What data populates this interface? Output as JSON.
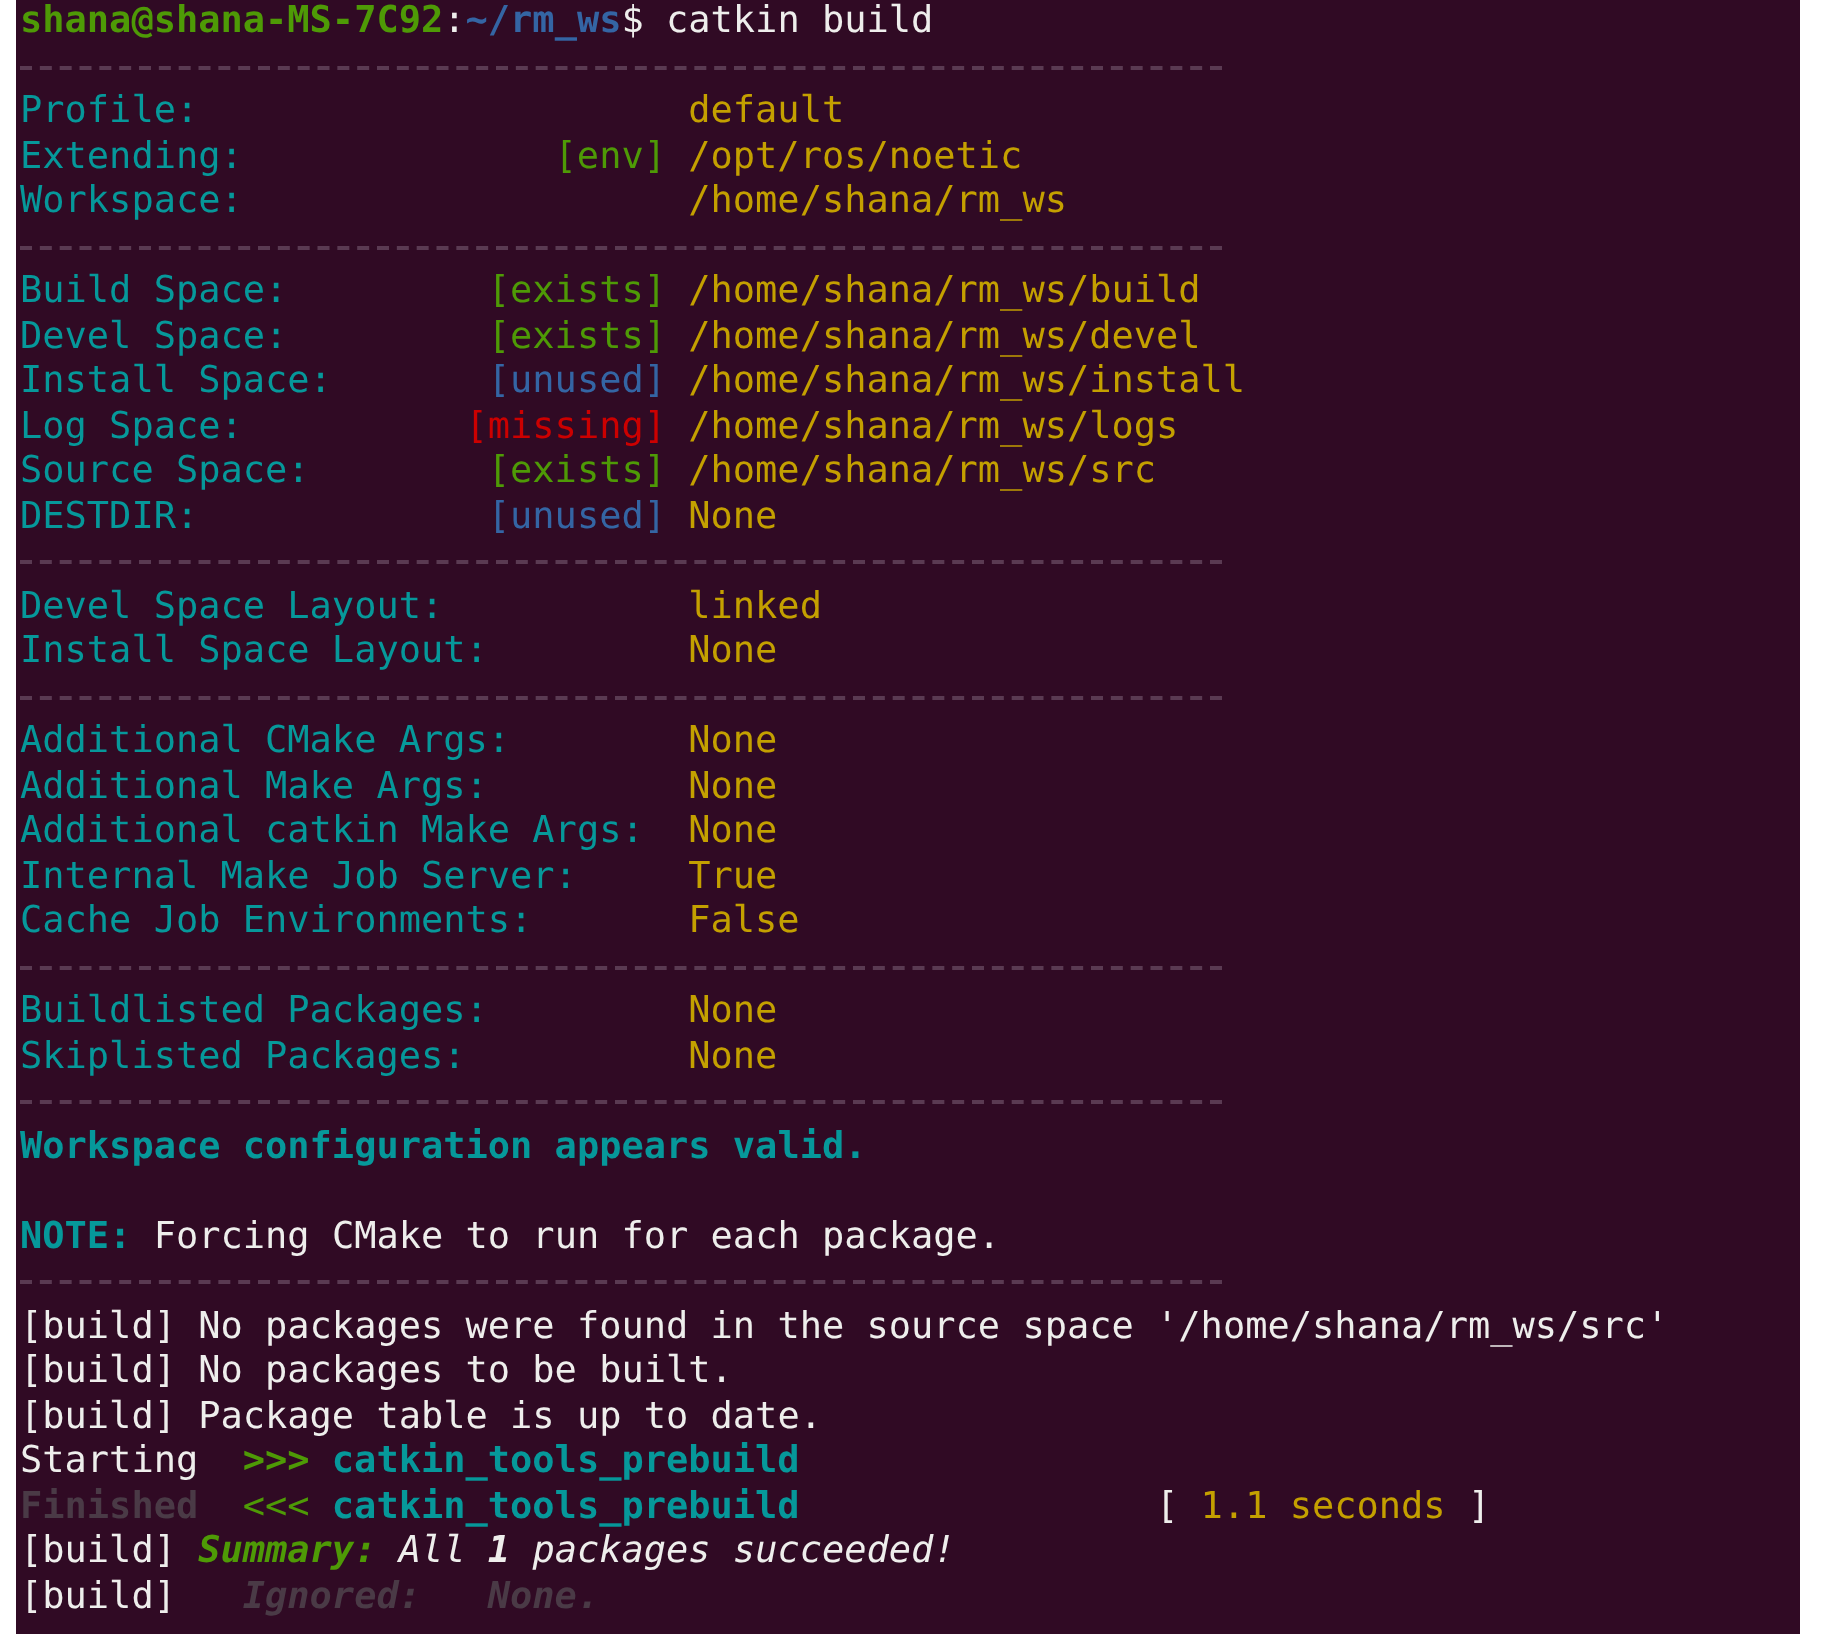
{
  "terminal": {
    "lines": [
      {
        "kind": "prompt",
        "user": "shana@shana-MS-7C92",
        "separator": ":",
        "path": "~/rm_ws",
        "symbol": "$",
        "command": "catkin build"
      },
      {
        "kind": "rule"
      },
      {
        "kind": "setting",
        "label": "Profile:",
        "value": "default"
      },
      {
        "kind": "setting",
        "label": "Extending:",
        "status": {
          "text": "[env]",
          "kind": "exists"
        },
        "value": "/opt/ros/noetic"
      },
      {
        "kind": "setting",
        "label": "Workspace:",
        "value": "/home/shana/rm_ws"
      },
      {
        "kind": "rule"
      },
      {
        "kind": "setting",
        "label": "Build Space:",
        "status": {
          "text": "[exists]",
          "kind": "exists"
        },
        "value": "/home/shana/rm_ws/build"
      },
      {
        "kind": "setting",
        "label": "Devel Space:",
        "status": {
          "text": "[exists]",
          "kind": "exists"
        },
        "value": "/home/shana/rm_ws/devel"
      },
      {
        "kind": "setting",
        "label": "Install Space:",
        "status": {
          "text": "[unused]",
          "kind": "unused"
        },
        "value": "/home/shana/rm_ws/install"
      },
      {
        "kind": "setting",
        "label": "Log Space:",
        "status": {
          "text": "[missing]",
          "kind": "missing"
        },
        "value": "/home/shana/rm_ws/logs"
      },
      {
        "kind": "setting",
        "label": "Source Space:",
        "status": {
          "text": "[exists]",
          "kind": "exists"
        },
        "value": "/home/shana/rm_ws/src"
      },
      {
        "kind": "setting",
        "label": "DESTDIR:",
        "status": {
          "text": "[unused]",
          "kind": "unused"
        },
        "value": "None"
      },
      {
        "kind": "rule"
      },
      {
        "kind": "setting",
        "label": "Devel Space Layout:",
        "value": "linked"
      },
      {
        "kind": "setting",
        "label": "Install Space Layout:",
        "value": "None"
      },
      {
        "kind": "rule"
      },
      {
        "kind": "setting",
        "label": "Additional CMake Args:",
        "value": "None"
      },
      {
        "kind": "setting",
        "label": "Additional Make Args:",
        "value": "None"
      },
      {
        "kind": "setting",
        "label": "Additional catkin Make Args:",
        "value": "None"
      },
      {
        "kind": "setting",
        "label": "Internal Make Job Server:",
        "value": "True"
      },
      {
        "kind": "setting",
        "label": "Cache Job Environments:",
        "value": "False"
      },
      {
        "kind": "rule"
      },
      {
        "kind": "setting",
        "label": "Buildlisted Packages:",
        "value": "None"
      },
      {
        "kind": "setting",
        "label": "Skiplisted Packages:",
        "value": "None"
      },
      {
        "kind": "rule"
      },
      {
        "kind": "message",
        "segments": [
          {
            "text": "Workspace configuration appears valid.",
            "kind": "heading"
          }
        ]
      },
      {
        "kind": "blank"
      },
      {
        "kind": "message",
        "segments": [
          {
            "text": "NOTE:",
            "kind": "heading"
          },
          {
            "text": " Forcing CMake to run for each package.",
            "kind": "plain"
          }
        ]
      },
      {
        "kind": "rule"
      },
      {
        "kind": "message",
        "segments": [
          {
            "text": "[build] No packages were found in the source space '/home/shana/rm_ws/src'",
            "kind": "plain"
          }
        ]
      },
      {
        "kind": "message",
        "segments": [
          {
            "text": "[build] No packages to be built.",
            "kind": "plain"
          }
        ]
      },
      {
        "kind": "message",
        "segments": [
          {
            "text": "[build] Package table is up to date.",
            "kind": "plain"
          }
        ]
      },
      {
        "kind": "job",
        "verb": "Starting",
        "done": false,
        "arrow": ">>>",
        "package": "catkin_tools_prebuild"
      },
      {
        "kind": "job",
        "verb": "Finished",
        "done": true,
        "arrow": "<<<",
        "package": "catkin_tools_prebuild",
        "time": {
          "open": "[",
          "duration": "1.1 seconds",
          "close": "]"
        }
      },
      {
        "kind": "message",
        "segments": [
          {
            "text": "[build] ",
            "kind": "plain"
          },
          {
            "text": "Summary:",
            "kind": "success"
          },
          {
            "text": " All ",
            "kind": "italic"
          },
          {
            "text": "1",
            "kind": "bold_italic"
          },
          {
            "text": " packages succeeded!",
            "kind": "italic"
          }
        ]
      },
      {
        "kind": "detail",
        "prefix": "[build]",
        "label": "Ignored:",
        "value": "None."
      }
    ]
  }
}
